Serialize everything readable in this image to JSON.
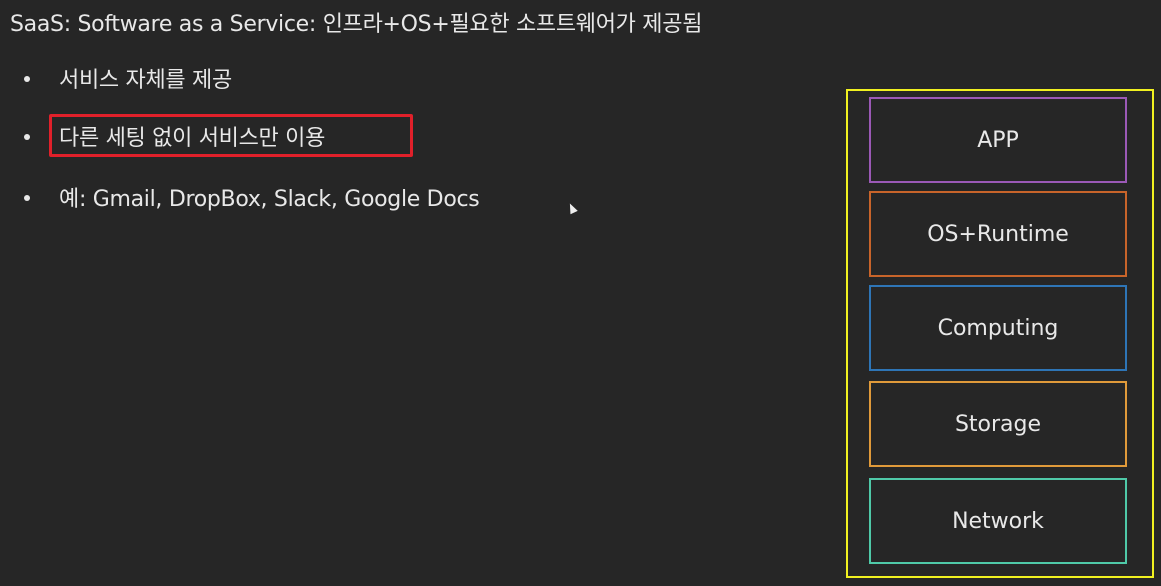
{
  "slide": {
    "title": "SaaS: Software as a Service: 인프라+OS+필요한 소프트웨어가 제공됨",
    "bullets": [
      "서비스 자체를 제공",
      "다른 세팅 없이 서비스만 이용",
      "예: Gmail, DropBox, Slack, Google Docs"
    ],
    "highlighted_bullet_index": 1,
    "highlight_color": "#e0202a"
  },
  "stack_diagram": {
    "outer_border_color": "#f0f020",
    "layers": [
      {
        "label": "APP",
        "color": "#9b59b6"
      },
      {
        "label": "OS+Runtime",
        "color": "#c8642a"
      },
      {
        "label": "Computing",
        "color": "#2e75b6"
      },
      {
        "label": "Storage",
        "color": "#e09a3a"
      },
      {
        "label": "Network",
        "color": "#4fc9a8"
      }
    ]
  }
}
